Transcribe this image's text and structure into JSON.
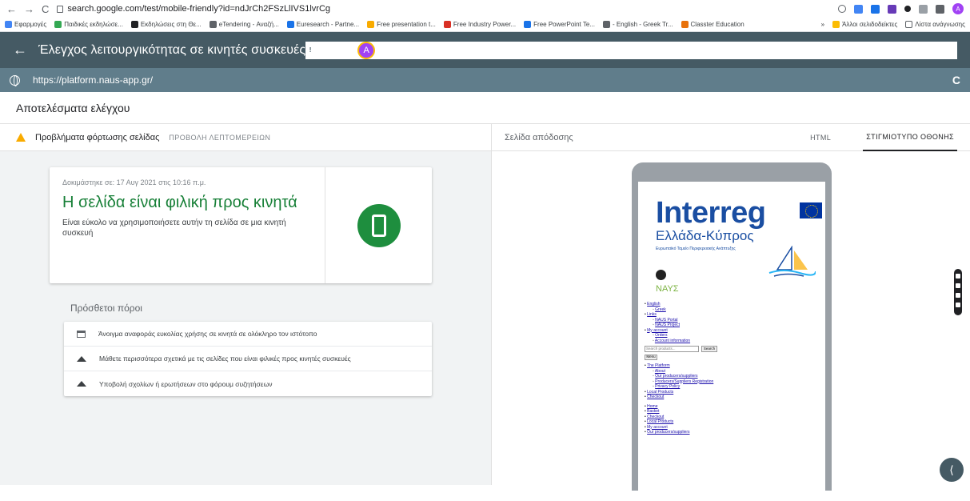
{
  "browser": {
    "url": "search.google.com/test/mobile-friendly?id=ndJrCh2FSzLlIVS1lvrCg",
    "back_glyph": "←",
    "forward_glyph": "→",
    "reload_glyph": "C"
  },
  "bookmarks": [
    {
      "label": "Εφαρμογές",
      "color": "#4285f4",
      "icon": "apps-icon"
    },
    {
      "label": "Παιδικές εκδηλώσε...",
      "color": "#34a853",
      "icon": "bookmark-icon"
    },
    {
      "label": "Εκδηλώσεις στη Θε...",
      "color": "#202124",
      "icon": "bookmark-icon"
    },
    {
      "label": "eTendering - Αναζή...",
      "color": "#5f6368",
      "icon": "bookmark-icon"
    },
    {
      "label": "Euresearch - Partne...",
      "color": "#1a73e8",
      "icon": "bookmark-icon"
    },
    {
      "label": "Free presentation t...",
      "color": "#f9ab00",
      "icon": "bookmark-icon"
    },
    {
      "label": "Free Industry Power...",
      "color": "#d93025",
      "icon": "bookmark-icon"
    },
    {
      "label": "Free PowerPoint Te...",
      "color": "#1a73e8",
      "icon": "bookmark-icon"
    },
    {
      "label": "- English - Greek Tr...",
      "color": "#5f6368",
      "icon": "bookmark-icon"
    },
    {
      "label": "Classter Education",
      "color": "#e8710a",
      "icon": "bookmark-icon"
    }
  ],
  "bookmarks_right": {
    "chevron": "»",
    "other": "Άλλοι σελιδοδείκτες",
    "reading": "Λίστα ανάγνωσης"
  },
  "appbar": {
    "back_glyph": "←",
    "title": "Έλεγχος λειτουργικότητας σε κινητές συσκευές",
    "feedback_glyph": "!",
    "avatar_letter": "A"
  },
  "tested_url": "https://platform.naus-app.gr/",
  "results_title": "Αποτελέσματα ελέγχου",
  "tabs": {
    "issues": "Προβλήματα φόρτωσης σελίδας",
    "details": "ΠΡΟΒΟΛΗ ΛΕΠΤΟΜΕΡΕΙΩΝ",
    "rendered": "Σελίδα απόδοσης",
    "html": "HTML",
    "screenshot": "ΣΤΙΓΜΙΟΤΥΠΟ ΟΘΟΝΗΣ"
  },
  "result_card": {
    "date": "Δοκιμάστηκε σε: 17 Αυγ 2021 στις 10:16 π.μ.",
    "title": "Η σελίδα είναι φιλική προς κινητά",
    "description": "Είναι εύκολο να χρησιμοποιήσετε αυτήν τη σελίδα σε μια κινητή συσκευή",
    "status_color": "#1e8e3e"
  },
  "resources": {
    "title": "Πρόσθετοι πόροι",
    "items": [
      {
        "label": "Άνοιγμα αναφοράς ευκολίας χρήσης σε κινητά σε ολόκληρο τον ιστότοπο",
        "icon": "report-icon"
      },
      {
        "label": "Μάθετε περισσότερα σχετικά με τις σελίδες που είναι φιλικές προς κινητές συσκευές",
        "icon": "school-icon"
      },
      {
        "label": "Υποβολή σχολίων ή ερωτήσεων στο φόρουμ συζητήσεων",
        "icon": "school-icon"
      }
    ]
  },
  "preview": {
    "logo_big": "Interreg",
    "logo_region": "Ελλάδα-Κύπρος",
    "logo_fund": "Ευρωπαϊκό Ταμείο Περιφερειακής Ανάπτυξης",
    "naus": "ΝΑΥΣ",
    "links1": [
      {
        "text": "English",
        "level": 0
      },
      {
        "text": "Greek",
        "level": 1
      },
      {
        "text": "Links",
        "level": 0
      },
      {
        "text": "NAUS Portal",
        "level": 1
      },
      {
        "text": "NAUS Project",
        "level": 1
      },
      {
        "text": "My account",
        "level": 0
      },
      {
        "text": "Orders",
        "level": 1
      },
      {
        "text": "Account information",
        "level": 1
      }
    ],
    "search_placeholder": "Search products...",
    "search_btn": "Search",
    "menu_btn": "Menu",
    "links2": [
      {
        "text": "The Platform",
        "level": 0
      },
      {
        "text": "About",
        "level": 1
      },
      {
        "text": "Our producers/suppliers",
        "level": 1
      },
      {
        "text": "Producers/Suppliers Registration",
        "level": 1
      },
      {
        "text": "Privacy Policy",
        "level": 1
      },
      {
        "text": "Local Products",
        "level": 0
      },
      {
        "text": "Checkout",
        "level": 0
      }
    ],
    "links3": [
      {
        "text": "Home",
        "level": 0
      },
      {
        "text": "Basket",
        "level": 0
      },
      {
        "text": "Checkout",
        "level": 0
      },
      {
        "text": "Local Products",
        "level": 0
      },
      {
        "text": "My account",
        "level": 0
      },
      {
        "text": "Our producers/suppliers",
        "level": 0
      }
    ]
  }
}
